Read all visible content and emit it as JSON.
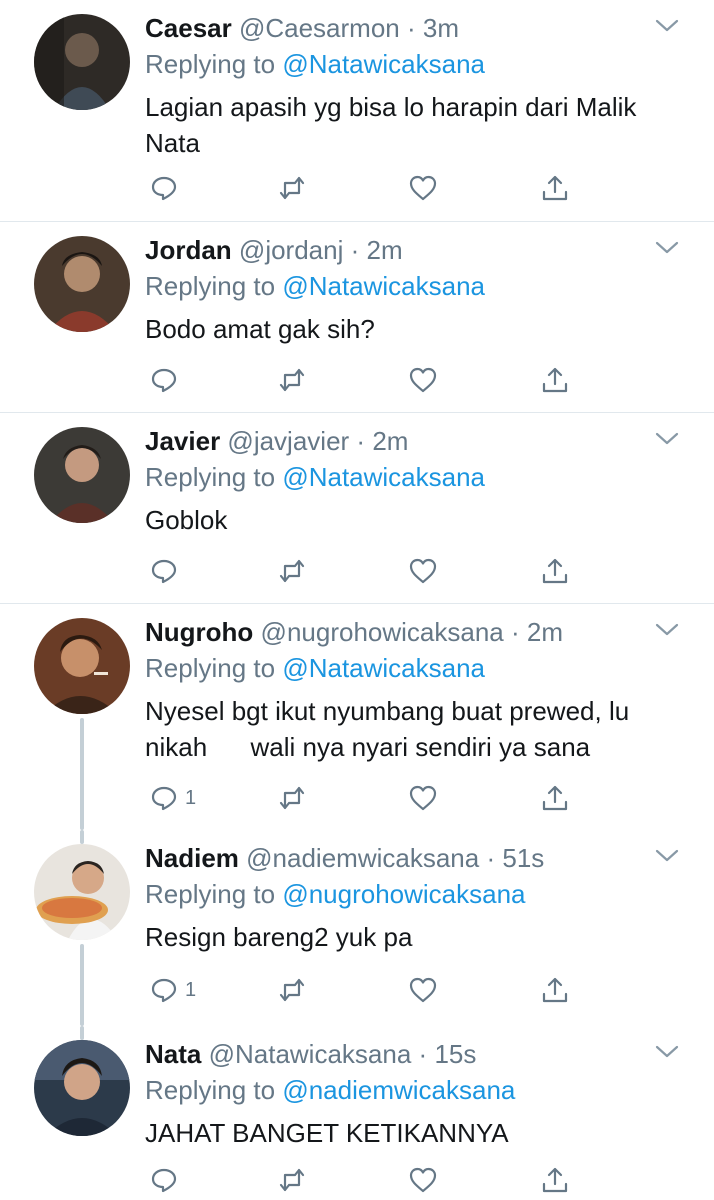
{
  "colors": {
    "name": "#14171a",
    "secondary": "#657786",
    "mention": "#1b95e0",
    "divider": "#e1e8ed",
    "thread": "#c4cfd6"
  },
  "reply_prefix": "Replying to",
  "tweets": [
    {
      "name": "Caesar",
      "handle": "@Caesarmon",
      "dot": "·",
      "time": "3m",
      "reply_to": "@Natawicaksana",
      "text": "Lagian apasih yg bisa lo harapin dari Malik Nata",
      "reply_count": ""
    },
    {
      "name": "Jordan",
      "handle": "@jordanj",
      "dot": "·",
      "time": "2m",
      "reply_to": "@Natawicaksana",
      "text": "Bodo amat gak sih?",
      "reply_count": ""
    },
    {
      "name": "Javier",
      "handle": "@javjavier",
      "dot": "·",
      "time": "2m",
      "reply_to": "@Natawicaksana",
      "text": "Goblok",
      "reply_count": ""
    },
    {
      "name": "Nugroho",
      "handle": "@nugrohowicaksana",
      "dot": "·",
      "time": "2m",
      "reply_to": "@Natawicaksana",
      "text": "Nyesel bgt ikut nyumbang buat prewed, lu nikah      wali nya nyari sendiri ya sana",
      "reply_count": "1"
    },
    {
      "name": "Nadiem",
      "handle": "@nadiemwicaksana",
      "dot": "·",
      "time": "51s",
      "reply_to": "@nugrohowicaksana",
      "text": "Resign bareng2 yuk pa",
      "reply_count": "1"
    },
    {
      "name": "Nata",
      "handle": "@Natawicaksana",
      "dot": "·",
      "time": "15s",
      "reply_to": "@nadiemwicaksana",
      "text": "JAHAT BANGET KETIKANNYA",
      "reply_count": ""
    }
  ]
}
